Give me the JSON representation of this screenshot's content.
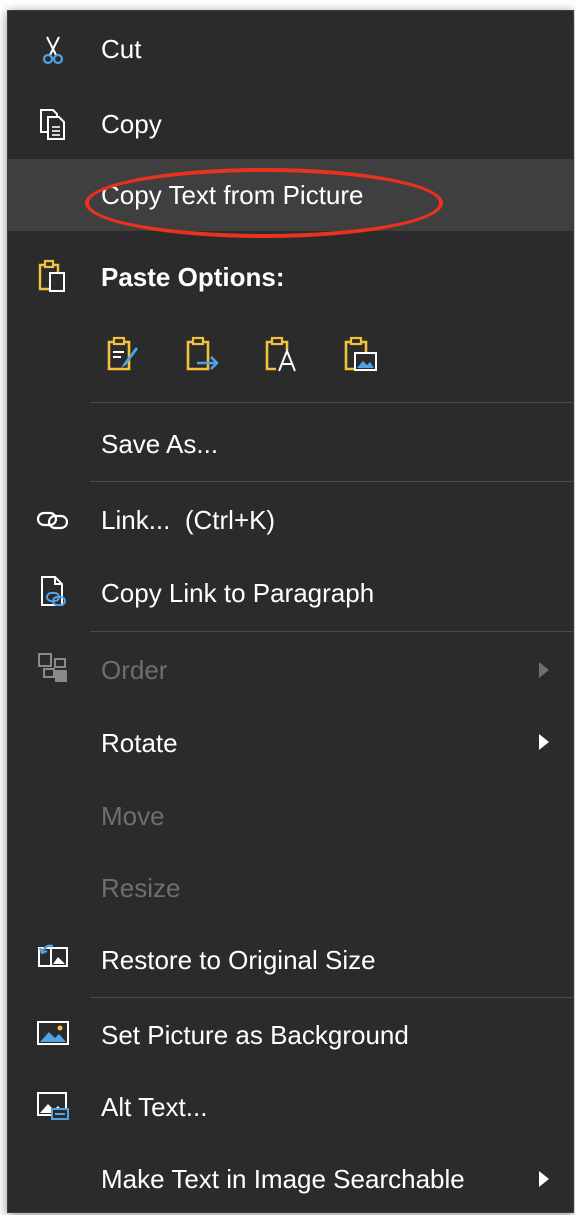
{
  "colors": {
    "menu_bg": "#2b2b2b",
    "highlight_bg": "#3f3f3f",
    "text": "#ffffff",
    "disabled_text": "#6e6e6e",
    "accent_yellow": "#f2c23a",
    "accent_blue": "#4fa3e6",
    "annotation_red": "#e8311f"
  },
  "menu": {
    "cut": {
      "label": "Cut",
      "icon": "scissors-icon"
    },
    "copy": {
      "label": "Copy",
      "icon": "copy-icon"
    },
    "copy_text_from_picture": {
      "label": "Copy Text from Picture",
      "highlighted": true,
      "annotated": true
    },
    "paste_options": {
      "label": "Paste Options:",
      "icon": "clipboard-icon",
      "buttons": [
        {
          "name": "paste-keep-source-formatting",
          "icon": "clipboard-brush-icon"
        },
        {
          "name": "paste-merge-formatting",
          "icon": "clipboard-arrow-icon"
        },
        {
          "name": "paste-keep-text-only",
          "icon": "clipboard-text-icon"
        },
        {
          "name": "paste-as-picture",
          "icon": "clipboard-picture-icon"
        }
      ]
    },
    "save_as": {
      "label": "Save As..."
    },
    "link": {
      "label": "Link...  (Ctrl+K)",
      "icon": "link-icon"
    },
    "copy_link_to_paragraph": {
      "label": "Copy Link to Paragraph",
      "icon": "document-link-icon"
    },
    "order": {
      "label": "Order",
      "icon": "order-icon",
      "disabled": true,
      "submenu": true
    },
    "rotate": {
      "label": "Rotate",
      "submenu": true
    },
    "move": {
      "label": "Move",
      "disabled": true
    },
    "resize": {
      "label": "Resize",
      "disabled": true
    },
    "restore_size": {
      "label": "Restore to Original Size",
      "icon": "restore-picture-icon"
    },
    "set_background": {
      "label": "Set Picture as Background",
      "icon": "picture-background-icon"
    },
    "alt_text": {
      "label": "Alt Text...",
      "icon": "alt-text-icon"
    },
    "make_searchable": {
      "label": "Make Text in Image Searchable",
      "submenu": true
    }
  }
}
